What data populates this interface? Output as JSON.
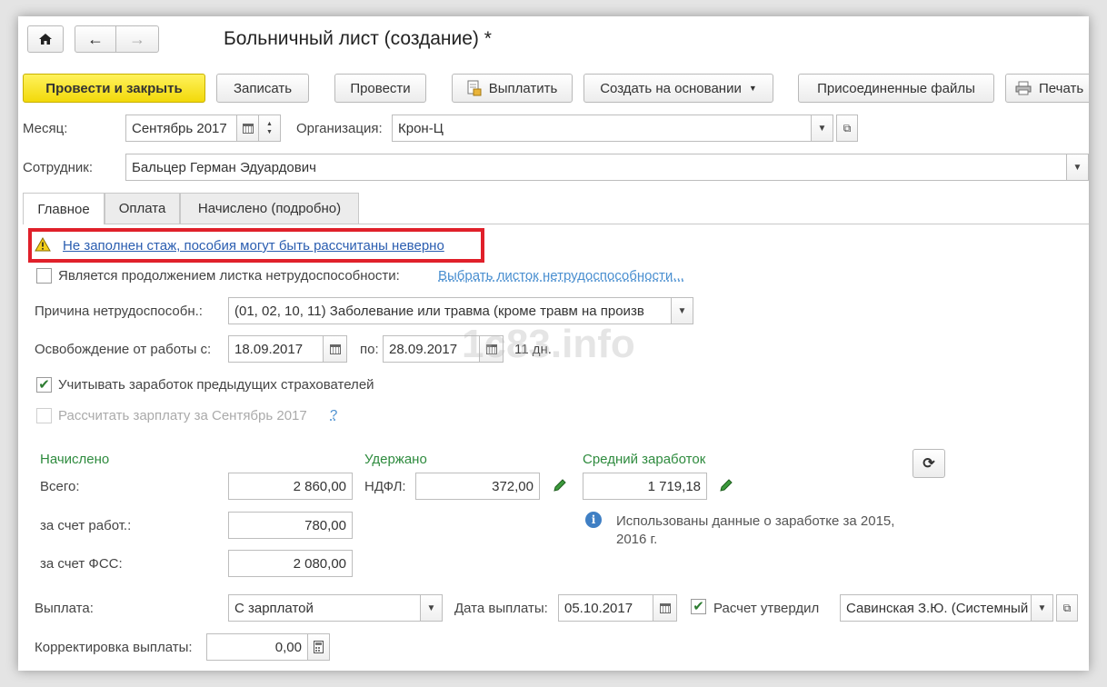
{
  "window": {
    "title": "Больничный лист (создание) *"
  },
  "toolbar": {
    "post_close": "Провести и закрыть",
    "save": "Записать",
    "post": "Провести",
    "pay": "Выплатить",
    "create_based_on": "Создать на основании",
    "attached_files": "Присоединенные файлы",
    "print": "Печать"
  },
  "header": {
    "month_label": "Месяц:",
    "month_value": "Сентябрь 2017",
    "org_label": "Организация:",
    "org_value": "Крон-Ц",
    "employee_label": "Сотрудник:",
    "employee_value": "Бальцер Герман Эдуардович"
  },
  "tabs": [
    {
      "label": "Главное",
      "active": true
    },
    {
      "label": "Оплата",
      "active": false
    },
    {
      "label": "Начислено (подробно)",
      "active": false
    }
  ],
  "main": {
    "warning": "Не заполнен стаж, пособия могут быть рассчитаны неверно",
    "continuation_label": "Является продолжением листка нетрудоспособности:",
    "continuation_link": "Выбрать листок нетрудоспособности...",
    "reason_label": "Причина нетрудоспособн.:",
    "reason_value": "(01, 02, 10, 11) Заболевание или травма (кроме травм на произв",
    "release_label": "Освобождение от работы с:",
    "date_from": "18.09.2017",
    "to_label": "по:",
    "date_to": "28.09.2017",
    "days": "11 дн.",
    "prev_insurers_label": "Учитывать заработок предыдущих страхователей",
    "prev_insurers_checked": true,
    "calc_salary_label": "Рассчитать зарплату за Сентябрь 2017",
    "calc_salary_help": "?",
    "calc_salary_checked": false
  },
  "accrued": {
    "heading": "Начислено",
    "total_label": "Всего:",
    "total_value": "2 860,00",
    "employer_label": "за счет работ.:",
    "employer_value": "780,00",
    "fss_label": "за счет ФСС:",
    "fss_value": "2 080,00"
  },
  "withheld": {
    "heading": "Удержано",
    "ndfl_label": "НДФЛ:",
    "ndfl_value": "372,00"
  },
  "average": {
    "heading": "Средний заработок",
    "value": "1 719,18",
    "info": "Использованы данные о заработке за 2015,  2016 г."
  },
  "payment": {
    "label": "Выплата:",
    "value": "С зарплатой",
    "date_label": "Дата выплаты:",
    "date_value": "05.10.2017",
    "approved_label": "Расчет утвердил",
    "approved_checked": true,
    "approver_value": "Савинская З.Ю. (Системный",
    "correction_label": "Корректировка выплаты:",
    "correction_value": "0,00"
  },
  "watermark": "1с83.info",
  "colors": {
    "accent_yellow": "#f5dc1a",
    "highlight_red": "#e0202a",
    "green_text": "#2e8b3e",
    "link_blue": "#2a5db0"
  }
}
